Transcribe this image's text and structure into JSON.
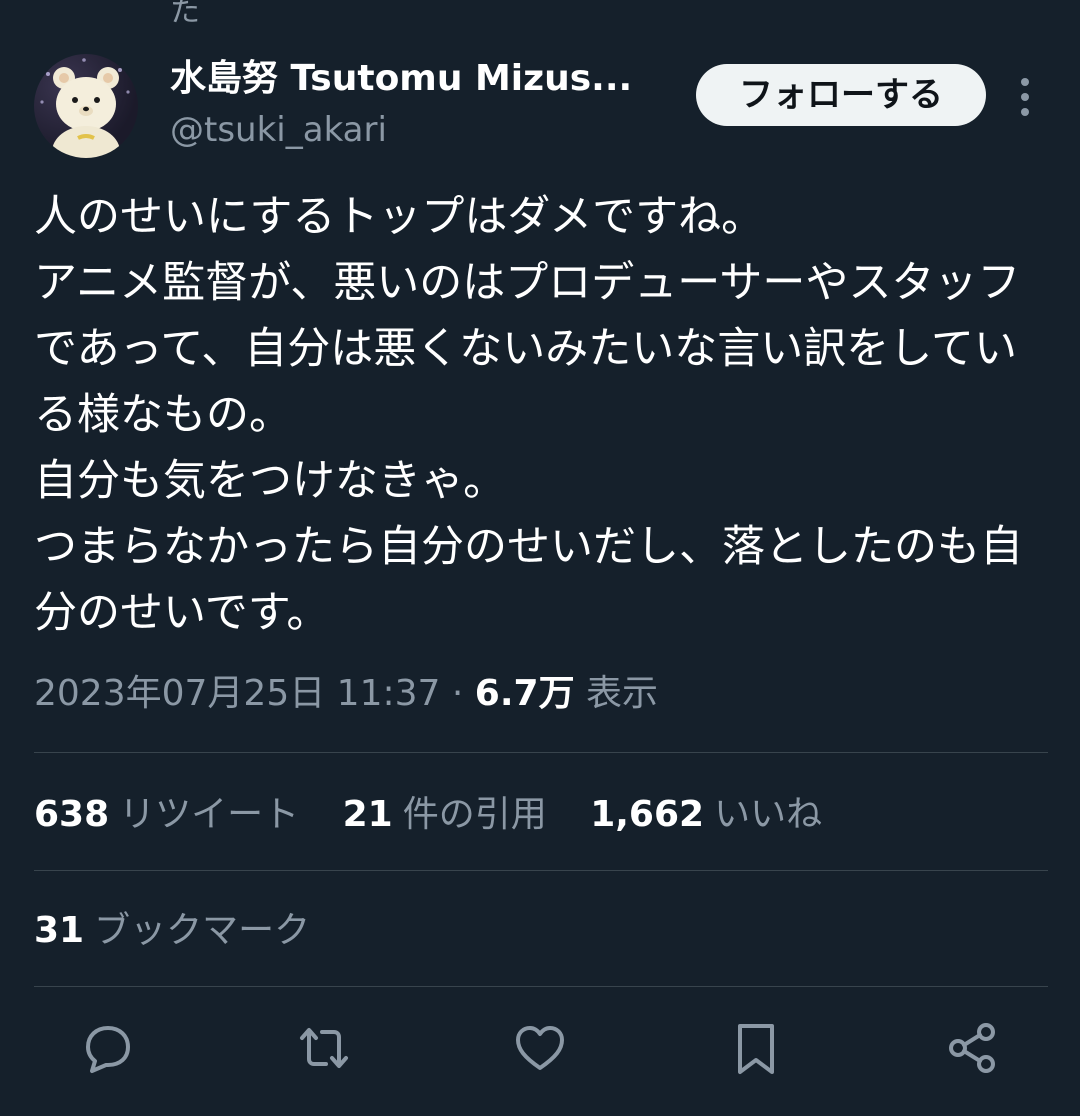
{
  "thread_tail": "た",
  "author": {
    "display_name": "水島努 Tsutomu Mizus...",
    "handle": "@tsuki_akari",
    "avatar_icon": "bear-avatar-icon"
  },
  "follow_label": "フォローする",
  "more_icon": "more-vertical-icon",
  "tweet": {
    "text": "人のせいにするトップはダメですね。\nアニメ監督が、悪いのはプロデューサーやスタッフであって、自分は悪くないみたいな言い訳をしている様なもの。\n自分も気をつけなきゃ。\nつまらなかったら自分のせいだし、落としたのも自分のせいです。"
  },
  "meta": {
    "timestamp": "2023年07月25日 11:37",
    "separator": "·",
    "views_count": "6.7万",
    "views_label": "表示"
  },
  "stats": {
    "retweets_count": "638",
    "retweets_label": "リツイート",
    "quotes_count": "21",
    "quotes_label": "件の引用",
    "likes_count": "1,662",
    "likes_label": "いいね",
    "bookmarks_count": "31",
    "bookmarks_label": "ブックマーク"
  },
  "actions": [
    "reply-icon",
    "retweet-icon",
    "like-icon",
    "bookmark-icon",
    "share-icon"
  ],
  "colors": {
    "background": "#15202b",
    "text_primary": "#ffffff",
    "text_secondary": "#8b98a5",
    "divider": "#38444d",
    "button_bg": "#eff3f4"
  }
}
